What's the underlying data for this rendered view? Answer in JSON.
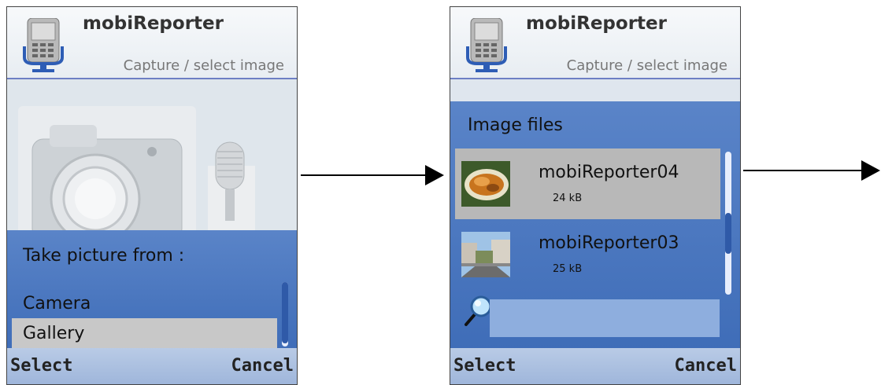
{
  "app": {
    "title": "mobiReporter",
    "subtitle": "Capture / select image"
  },
  "screen1": {
    "panel_title": "Take picture from :",
    "items": [
      {
        "label": "Camera"
      },
      {
        "label": "Gallery"
      }
    ],
    "selected_item": "Gallery",
    "softkeys": {
      "left": "Select",
      "right": "Cancel"
    }
  },
  "screen2": {
    "panel_title": "Image files",
    "files": [
      {
        "name": "mobiReporter04",
        "size": "24 kB",
        "thumbnail": "food-photo"
      },
      {
        "name": "mobiReporter03",
        "size": "25 kB",
        "thumbnail": "street-photo"
      }
    ],
    "selected_file": "mobiReporter04",
    "search": {
      "icon": "search-icon",
      "value": ""
    },
    "softkeys": {
      "left": "Select",
      "right": "Cancel"
    }
  },
  "colors": {
    "panel_blue": "#4a78c0",
    "header_line": "#6d7fc4",
    "selection_gray": "#c8c8c8"
  }
}
